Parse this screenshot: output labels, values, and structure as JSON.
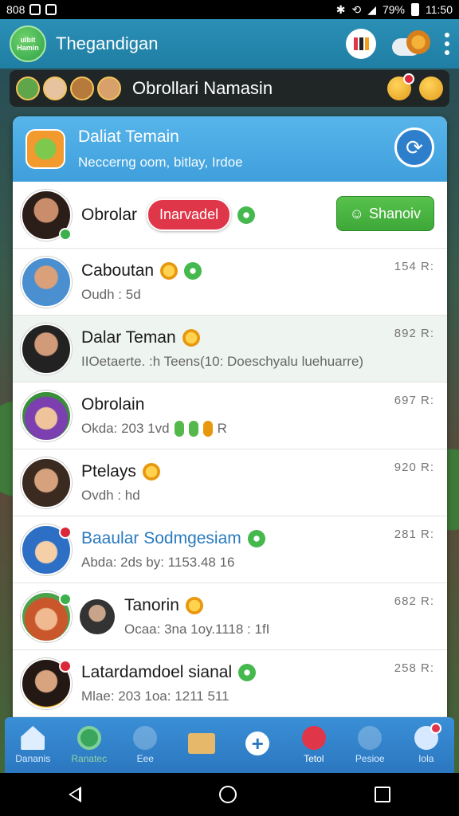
{
  "status_bar": {
    "left_text": "808",
    "battery": "79%",
    "time": "11:50"
  },
  "header": {
    "logo_text": "ulbit Hamin",
    "title": "Thegandigan",
    "icons": [
      "profile-badge-icon",
      "cloud-sun-icon",
      "kebab-menu-icon"
    ]
  },
  "banner": {
    "title": "Obrollari Namasin"
  },
  "panel": {
    "title": "Daliat Temain",
    "subtitle": "Neccerng oom, bitlay, Irdoe"
  },
  "chats": [
    {
      "name": "Obrolar",
      "badge": "Inarvadel",
      "action": "Shanoiv",
      "preview": "",
      "time": ""
    },
    {
      "name": "Caboutan",
      "preview": "Oudh : 5d",
      "time": "154 R:"
    },
    {
      "name": "Dalar Teman",
      "preview": "IIOetaerte. :h Teens(10: Doeschyalu luehuarre)",
      "time": "892 R:"
    },
    {
      "name": "Obrolain",
      "preview": "Okda: 203 1vd",
      "preview_suffix": "R",
      "time": "697 R:"
    },
    {
      "name": "Ptelays",
      "preview": "Ovdh : hd",
      "time": "920 R:"
    },
    {
      "name": "Baaular Sodmgesiam",
      "preview": "Abda: 2ds by: 1153.48 16",
      "time": "281 R:"
    },
    {
      "name": "Tanorin",
      "preview": "Ocaa: 3na 1oy.1118 : 1fI",
      "time": "682 R:"
    },
    {
      "name": "Latardamdoel sianal",
      "preview": "Mlae: 203 1oa: 1211 511",
      "time": "258 R:"
    }
  ],
  "bottom_nav": [
    {
      "label": "Dananis",
      "icon": "home-icon"
    },
    {
      "label": "Ranatec",
      "icon": "ring-icon"
    },
    {
      "label": "Eee",
      "icon": "clock-icon"
    },
    {
      "label": "",
      "icon": "envelope-icon"
    },
    {
      "label": "",
      "icon": "plus-icon"
    },
    {
      "label": "Tetol",
      "icon": "person-icon"
    },
    {
      "label": "Pesioe",
      "icon": "search-globe-icon"
    },
    {
      "label": "Iola",
      "icon": "cat-icon"
    }
  ],
  "colors": {
    "header": "#2b8fb6",
    "panel_header": "#4aa9e2",
    "badge_red": "#e0364a",
    "button_green": "#45b53f",
    "nav": "#3283cc"
  }
}
